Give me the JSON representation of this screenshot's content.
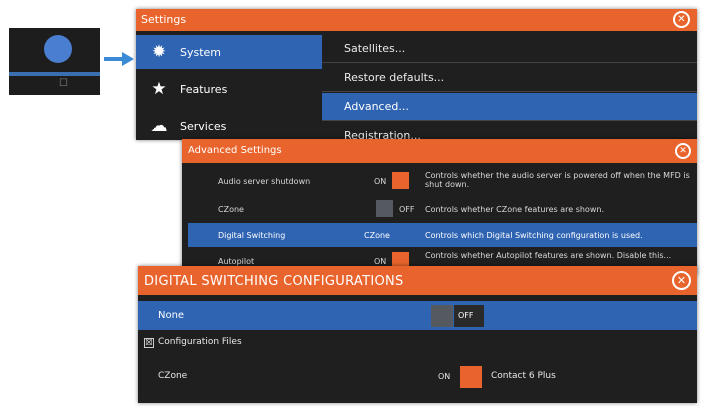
{
  "colors": {
    "accent": "#e8642c",
    "selection": "#2f64b3",
    "panel": "#1f1f1f",
    "switch_off": "#555a60"
  },
  "thumbnail": {
    "label": "☐"
  },
  "settings": {
    "title": "Settings",
    "sidebar": [
      {
        "label": "System",
        "icon": "gear-icon",
        "selected": true
      },
      {
        "label": "Features",
        "icon": "star-icon",
        "selected": false
      },
      {
        "label": "Services",
        "icon": "cloud-icon",
        "selected": false
      }
    ],
    "menu": [
      {
        "label": "Satellites...",
        "selected": false
      },
      {
        "label": "Restore defaults...",
        "selected": false
      },
      {
        "label": "Advanced...",
        "selected": true
      },
      {
        "label": "Registration...",
        "selected": false
      }
    ]
  },
  "advanced": {
    "title": "Advanced Settings",
    "rows": [
      {
        "name": "Audio server shutdown",
        "state": "ON",
        "description": "Controls whether the audio server is powered off when the MFD is shut down."
      },
      {
        "name": "CZone",
        "state": "OFF",
        "description": "Controls whether CZone features are shown."
      },
      {
        "name": "Digital Switching",
        "value": "CZone",
        "description": "Controls which Digital Switching configuration is used."
      },
      {
        "name": "Autopilot",
        "state": "ON",
        "description": "Controls whether Autopilot features are shown. Disable this..."
      }
    ]
  },
  "digital_switching": {
    "title": "DIGITAL SWITCHING CONFIGURATIONS",
    "none_row": {
      "label": "None",
      "state": "OFF"
    },
    "group": {
      "label": "Configuration Files",
      "checkbox": "☒"
    },
    "czone_row": {
      "label": "CZone",
      "state": "ON",
      "value": "Contact 6 Plus"
    }
  }
}
